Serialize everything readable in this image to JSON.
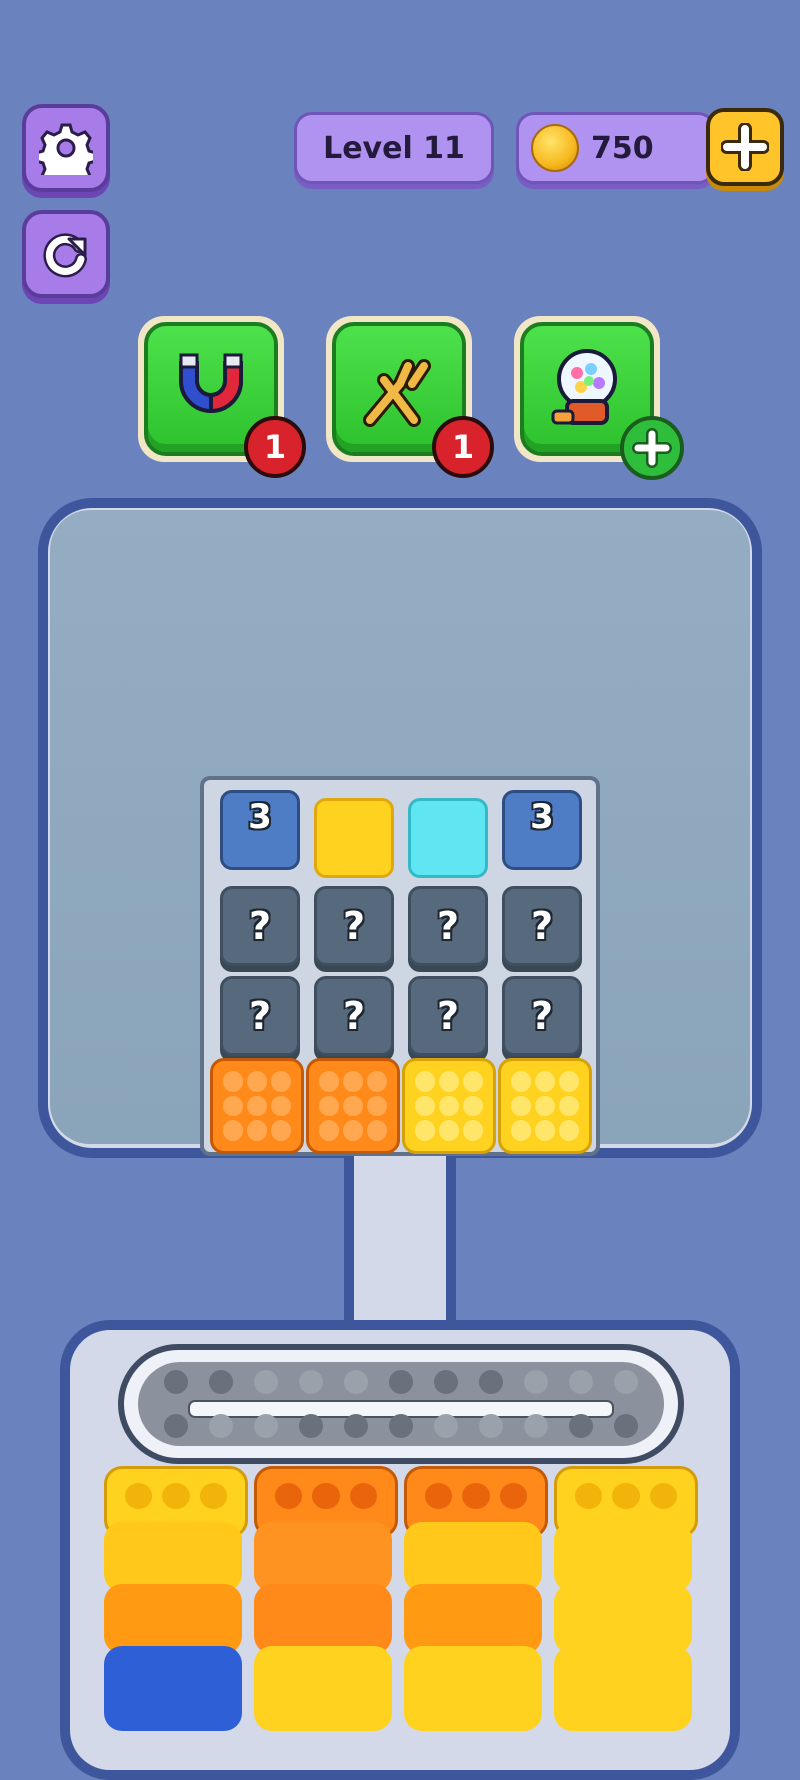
{
  "header": {
    "level_label": "Level 11",
    "coins": "750"
  },
  "boosters": [
    {
      "name": "magnet",
      "count": "1"
    },
    {
      "name": "shuffle",
      "count": "1"
    },
    {
      "name": "gumball",
      "count": ""
    }
  ],
  "board": {
    "top_row": [
      {
        "type": "stack",
        "value": "3"
      },
      {
        "type": "yellow"
      },
      {
        "type": "cyan"
      },
      {
        "type": "stack",
        "value": "3"
      }
    ],
    "hidden_label": "?",
    "colors": {
      "yellow": "#ffd21f",
      "cyan": "#5fe6f2",
      "orange": "#ff8a1a",
      "blue": "#2f5fd6"
    }
  }
}
